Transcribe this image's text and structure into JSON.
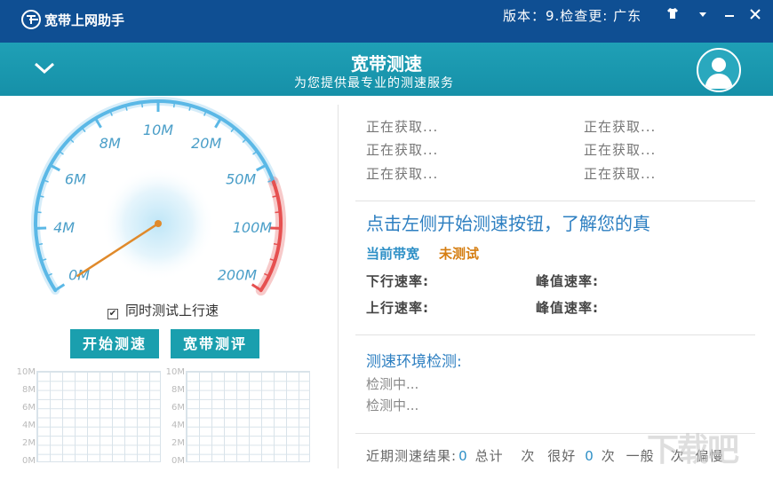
{
  "titlebar": {
    "app_name": "宽带上网助手",
    "version_text": "版本：9.检查更: 广东",
    "icons": [
      "shirt-icon",
      "dropdown-icon",
      "minimize-icon",
      "close-icon"
    ]
  },
  "header": {
    "title": "宽带测速",
    "subtitle": "为您提供最专业的测速服务",
    "left_icon": "chevron-down-icon",
    "right_icon": "user-avatar-icon"
  },
  "gauge": {
    "ticks": [
      "0M",
      "4M",
      "6M",
      "8M",
      "10M",
      "20M",
      "50M",
      "100M",
      "200M"
    ],
    "accent": "#5bb8e6",
    "danger": "#e65050",
    "needle_color": "#e08a2b"
  },
  "options": {
    "upload_checkbox_label": "同时测试上行速",
    "upload_checkbox_checked": true
  },
  "buttons": {
    "start_label": "开始测速",
    "review_label": "宽带测评"
  },
  "mini_charts": {
    "ylabels": [
      "10M",
      "8M",
      "6M",
      "4M",
      "2M",
      "0M"
    ]
  },
  "info": {
    "items": [
      "正在获取...",
      "正在获取...",
      "正在获取...",
      "正在获取...",
      "正在获取...",
      "正在获取..."
    ]
  },
  "result": {
    "prompt": "点击左侧开始测速按钮，了解您的真",
    "bandwidth_label": "当前带宽",
    "bandwidth_value": "未测试",
    "down_label": "下行速率:",
    "down_peak_label": "峰值速率:",
    "up_label": "上行速率:",
    "up_peak_label": "峰值速率:"
  },
  "environment": {
    "title": "测速环境检测:",
    "items": [
      "检测中...",
      "检测中..."
    ]
  },
  "recent": {
    "label": "近期测速结果:",
    "total_count": "0",
    "total_unit": "总计",
    "times_unit": "次",
    "good_label": "很好",
    "good_count": "0",
    "normal_label": "一般",
    "normal_count": "",
    "slow_label": "偏慢"
  },
  "watermark": "下载吧"
}
